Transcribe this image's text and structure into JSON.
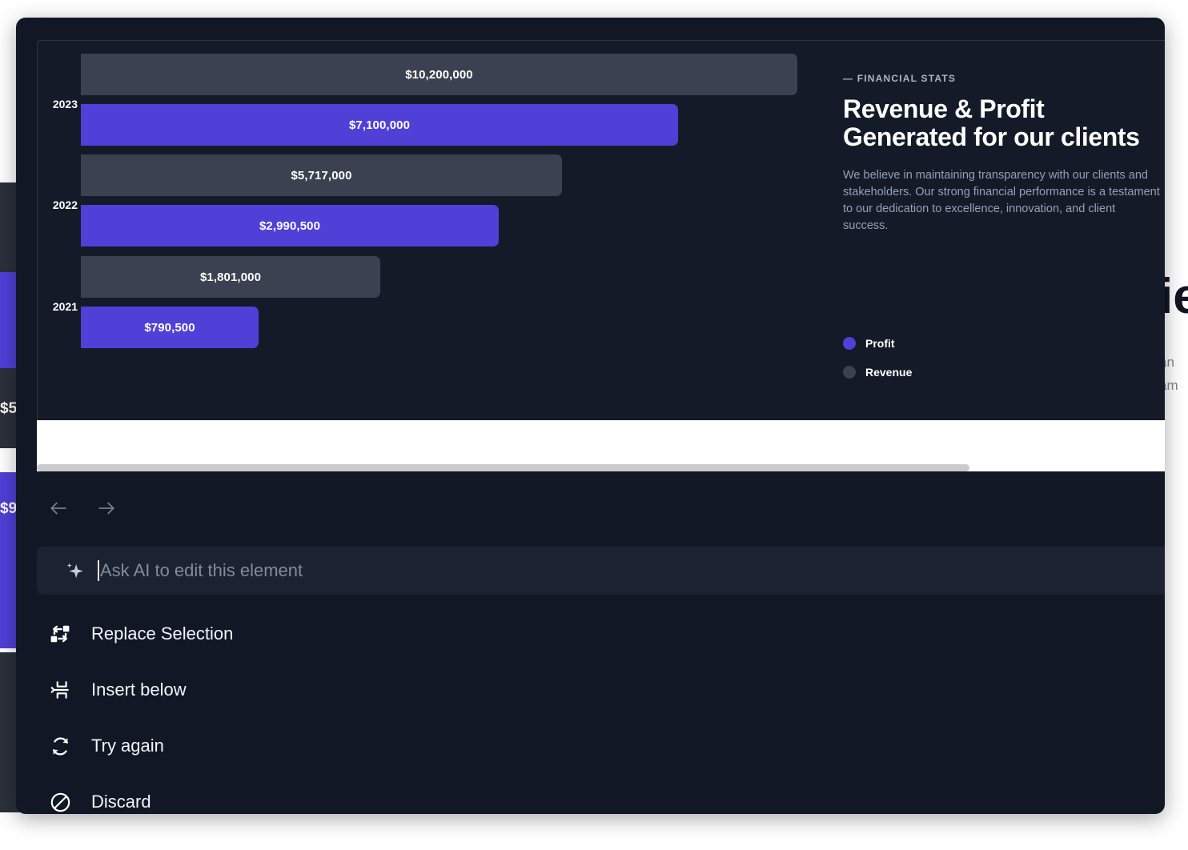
{
  "background": {
    "partial_value_top": "$5",
    "partial_value_bottom": "$9",
    "partial_title": "ie",
    "partial_body_line1": "an",
    "partial_body_line2": "am"
  },
  "info": {
    "eyebrow": "— FINANCIAL STATS",
    "headline": "Revenue & Profit\nGenerated for our clients",
    "blurb": "We believe in maintaining transparency with our clients and stakeholders. Our strong financial performance is a testament to our dedication to excellence, innovation, and client success."
  },
  "legend": [
    {
      "label": "Profit",
      "color": "#5040d8"
    },
    {
      "label": "Revenue",
      "color": "#3b4150"
    }
  ],
  "chart_data": {
    "type": "bar",
    "orientation": "horizontal",
    "title": "Revenue & Profit Generated for our clients",
    "xlabel": "",
    "ylabel": "",
    "grid": false,
    "legend_position": "right",
    "categories": [
      "2023",
      "2022",
      "2021"
    ],
    "series": [
      {
        "name": "Revenue",
        "color": "#3b4150",
        "values": [
          10200000,
          5717000,
          1801000
        ],
        "labels": [
          "$10,200,000",
          "$5,717,000",
          "$1,801,000"
        ]
      },
      {
        "name": "Profit",
        "color": "#5040d8",
        "values": [
          7100000,
          2990500,
          790500
        ],
        "labels": [
          "$7,100,000",
          "$2,990,500",
          "$790,500"
        ]
      }
    ],
    "xlim": [
      0,
      10200000
    ]
  },
  "toolbar": {
    "back_label": "Back",
    "forward_label": "Forward"
  },
  "ask": {
    "placeholder": "Ask AI to edit this element",
    "value": ""
  },
  "menu": [
    {
      "label": "Replace Selection",
      "icon": "replace-icon"
    },
    {
      "label": "Insert below",
      "icon": "insert-below-icon"
    },
    {
      "label": "Try again",
      "icon": "refresh-icon"
    },
    {
      "label": "Discard",
      "icon": "discard-icon"
    }
  ],
  "colors": {
    "accent": "#5040d8",
    "revenue": "#3b4150",
    "panel_bg": "#121726",
    "selection_bg": "#141a28"
  }
}
